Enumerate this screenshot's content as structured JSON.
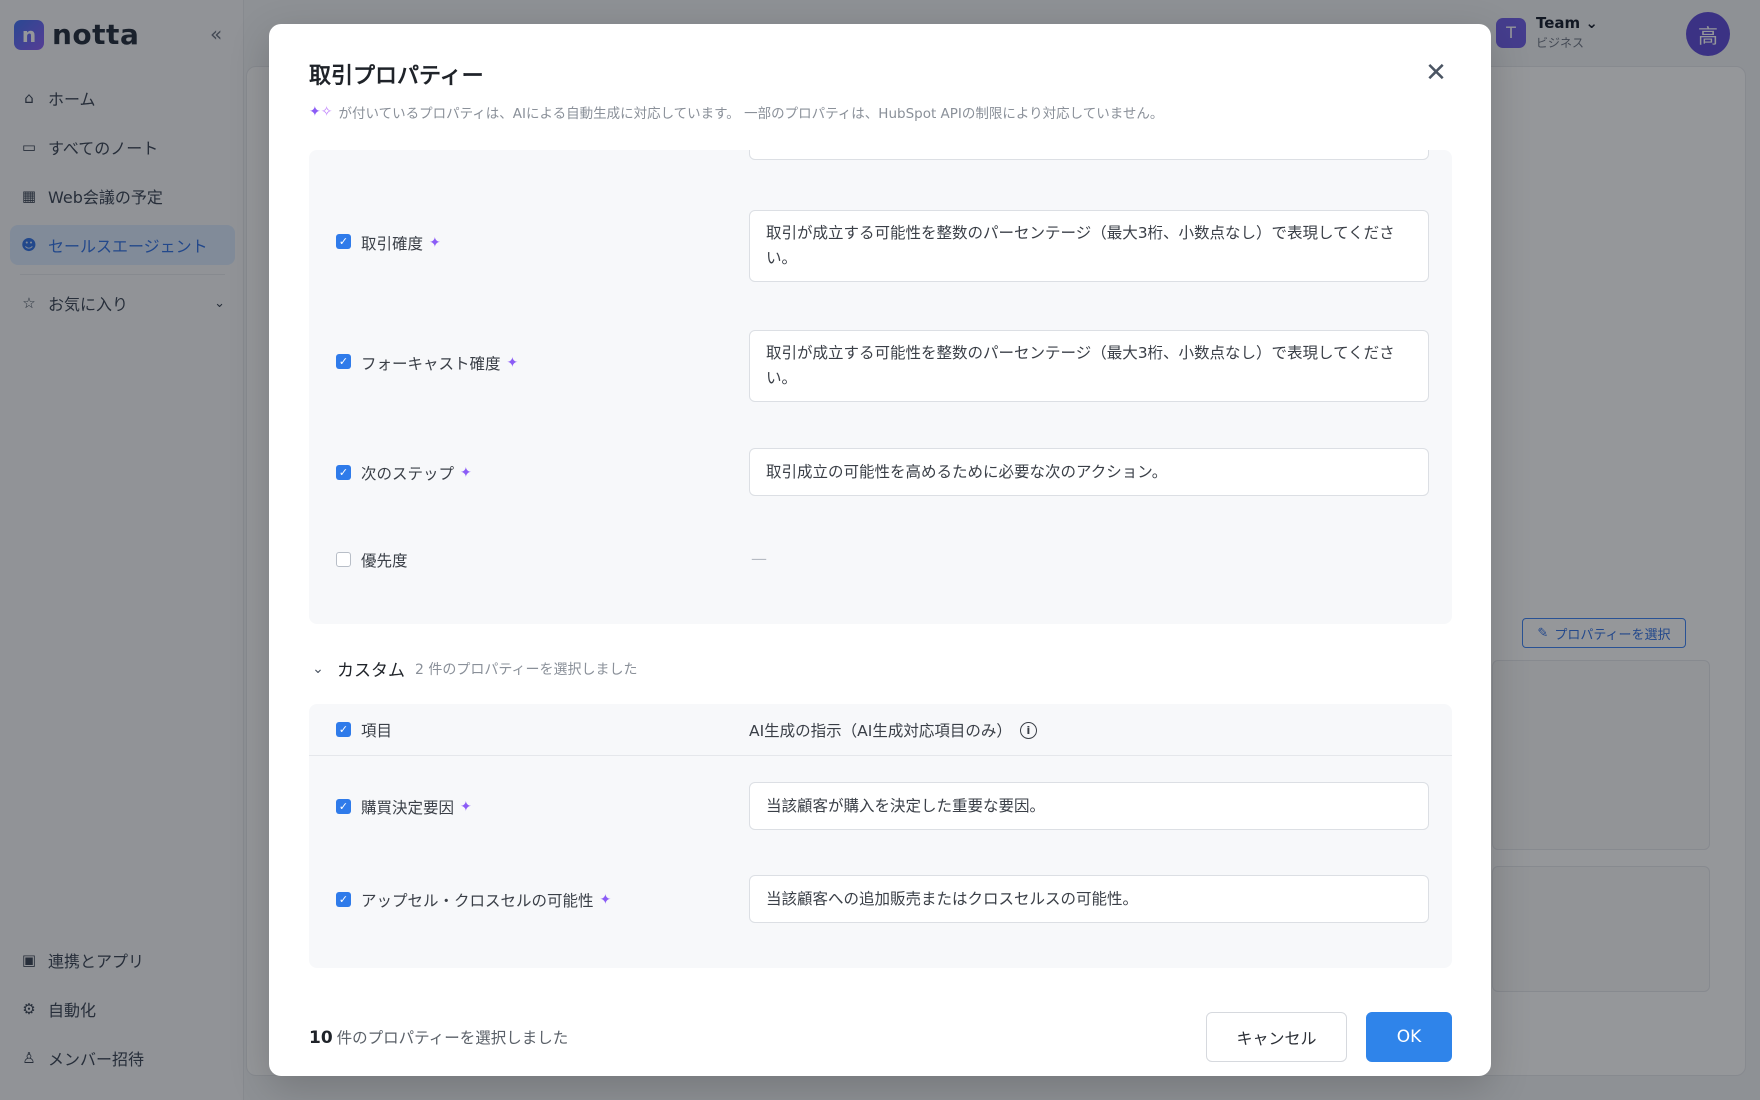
{
  "app": {
    "logo_mark": "n",
    "logo_text": "notta",
    "collapse_icon": "double-chevron-left-icon",
    "nav": [
      {
        "label": "ホーム",
        "icon": "home-icon"
      },
      {
        "label": "すべてのノート",
        "icon": "folder-icon"
      },
      {
        "label": "Web会議の予定",
        "icon": "calendar-icon"
      },
      {
        "label": "セールスエージェント",
        "icon": "robot-icon"
      },
      {
        "label": "お気に入り",
        "icon": "star-icon"
      }
    ],
    "nav_bottom": [
      {
        "label": "連携とアプリ",
        "icon": "briefcase-icon"
      },
      {
        "label": "自動化",
        "icon": "automation-icon"
      },
      {
        "label": "メンバー招待",
        "icon": "user-add-icon"
      }
    ],
    "team": {
      "avatar": "T",
      "name": "Team",
      "plan": "ビジネス"
    },
    "user_avatar": "高",
    "bg_select_button": "プロパティーを選択",
    "accent_color": "#2f84ea"
  },
  "modal": {
    "title": "取引プロパティー",
    "description": "が付いているプロパティは、AIによる自動生成に対応しています。 一部のプロパティは、HubSpot APIの制限により対応していません。",
    "standard_rows": [
      {
        "label": "取引確度",
        "checked": true,
        "ai": true,
        "value": "取引が成立する可能性を整数のパーセンテージ（最大3桁、小数点なし）で表現してください。"
      },
      {
        "label": "フォーキャスト確度",
        "checked": true,
        "ai": true,
        "value": "取引が成立する可能性を整数のパーセンテージ（最大3桁、小数点なし）で表現してください。"
      },
      {
        "label": "次のステップ",
        "checked": true,
        "ai": true,
        "value": "取引成立の可能性を高めるために必要な次のアクション。"
      },
      {
        "label": "優先度",
        "checked": false,
        "ai": false,
        "value": "—"
      }
    ],
    "custom_section": {
      "title": "カスタム",
      "count_text": "2 件のプロパティーを選択しました",
      "header_item": "項目",
      "header_instruction": "AI生成の指示（AI生成対応項目のみ）",
      "rows": [
        {
          "label": "購買決定要因",
          "checked": true,
          "ai": true,
          "value": "当該顧客が購入を決定した重要な要因。"
        },
        {
          "label": "アップセル・クロスセルの可能性",
          "checked": true,
          "ai": true,
          "value": "当該顧客への追加販売またはクロスセルスの可能性。"
        }
      ]
    },
    "footer": {
      "count": "10",
      "count_text": "件のプロパティーを選択しました",
      "cancel": "キャンセル",
      "ok": "OK"
    }
  }
}
